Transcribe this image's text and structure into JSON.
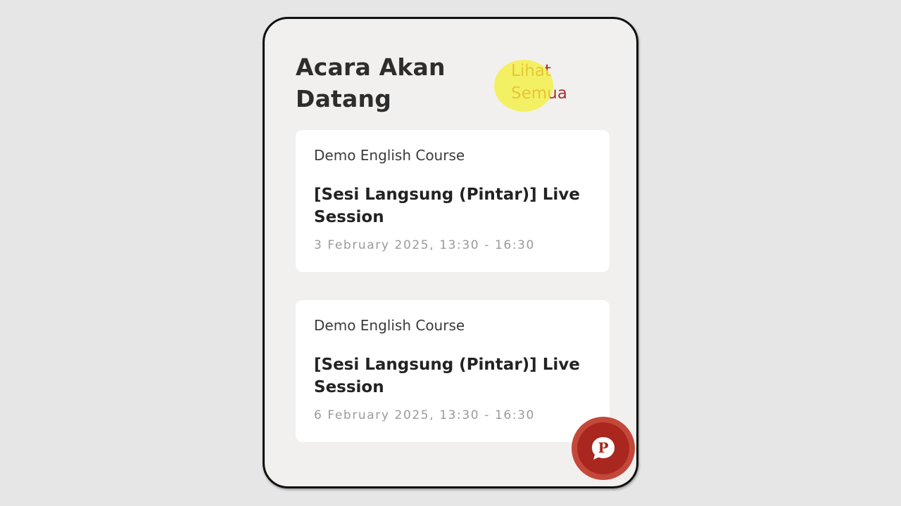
{
  "upcoming": {
    "title": "Acara Akan Datang",
    "see_all_label": "Lihat Semua"
  },
  "events": [
    {
      "course": "Demo English Course",
      "title": "[Sesi Langsung (Pintar)] Live Session",
      "datetime": "3 February 2025, 13:30 - 16:30"
    },
    {
      "course": "Demo English Course",
      "title": "[Sesi Langsung (Pintar)] Live Session",
      "datetime": "6 February 2025, 13:30 - 16:30"
    }
  ],
  "chat_button": {
    "icon": "chat-bubble-p-icon",
    "letter": "P"
  },
  "colors": {
    "accent": "#a8332a",
    "fab": "#a9271e",
    "highlight": "#f5f03c"
  }
}
